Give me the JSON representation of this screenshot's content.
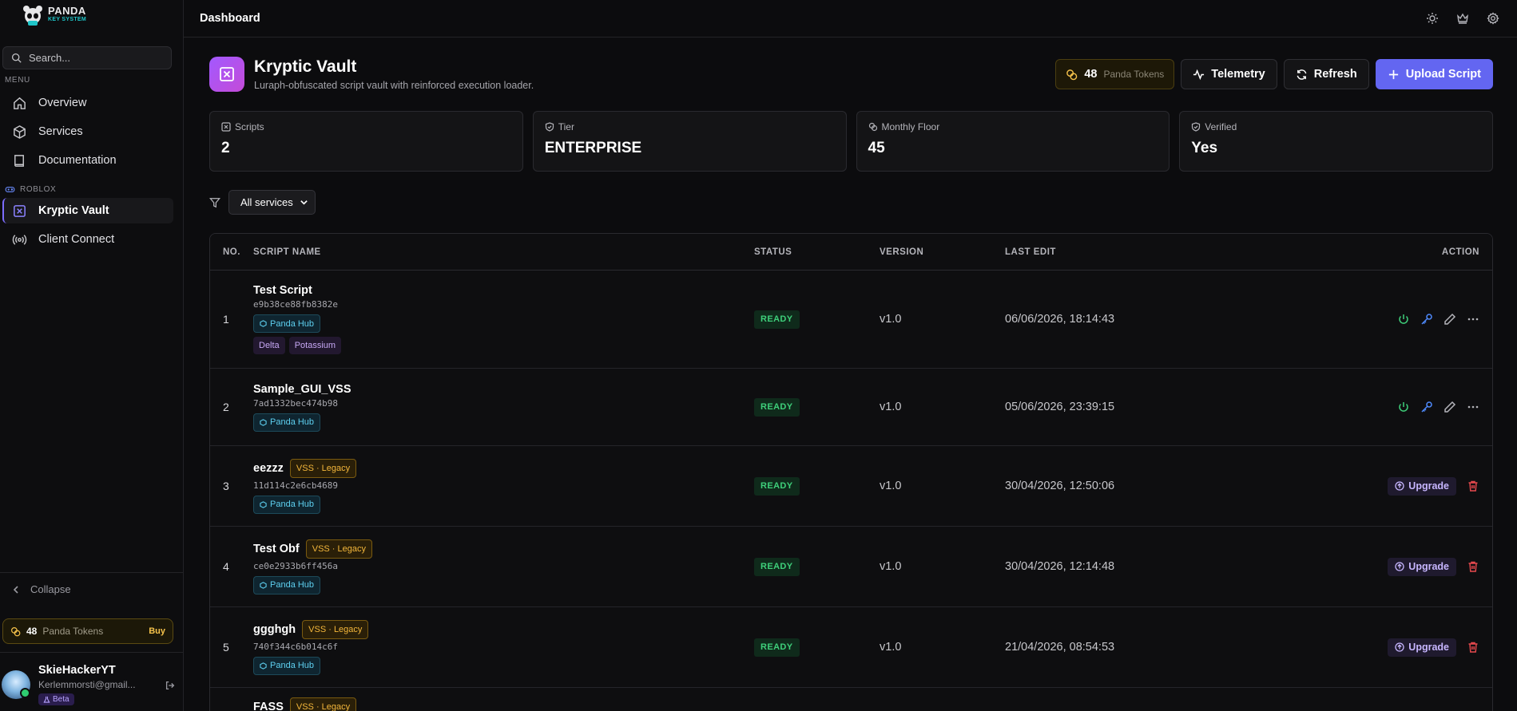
{
  "app": {
    "logo_line1": "PANDA",
    "logo_line2": "KEY SYSTEM"
  },
  "sidebar": {
    "search_placeholder": "Search...",
    "menu_label": "MENU",
    "menu_items": [
      {
        "label": "Overview",
        "icon": "home-icon"
      },
      {
        "label": "Services",
        "icon": "cube-icon"
      },
      {
        "label": "Documentation",
        "icon": "book-icon"
      }
    ],
    "roblox_label": "ROBLOX",
    "roblox_items": [
      {
        "label": "Kryptic Vault",
        "icon": "vault-icon",
        "active": true
      },
      {
        "label": "Client Connect",
        "icon": "broadcast-icon"
      }
    ],
    "collapse_label": "Collapse",
    "tokens": {
      "count": "48",
      "label": "Panda Tokens",
      "buy": "Buy"
    },
    "user": {
      "name": "SkieHackerYT",
      "email": "Kerlemmorsti@gmail...",
      "badge": "Beta"
    }
  },
  "topbar": {
    "title": "Dashboard",
    "icons": [
      "sun-icon",
      "crown-icon",
      "gear-icon"
    ]
  },
  "header": {
    "title": "Kryptic Vault",
    "subtitle": "Luraph-obfuscated script vault with reinforced execution loader.",
    "tokens_count": "48",
    "tokens_label": "Panda Tokens",
    "telemetry": "Telemetry",
    "refresh": "Refresh",
    "upload": "Upload Script"
  },
  "stats": [
    {
      "label": "Scripts",
      "value": "2"
    },
    {
      "label": "Tier",
      "value": "ENTERPRISE"
    },
    {
      "label": "Monthly Floor",
      "value": "45"
    },
    {
      "label": "Verified",
      "value": "Yes"
    }
  ],
  "filter": {
    "selected": "All services"
  },
  "table": {
    "headers": {
      "no": "NO.",
      "name": "SCRIPT NAME",
      "status": "STATUS",
      "version": "VERSION",
      "last_edit": "LAST EDIT",
      "action": "ACTION"
    },
    "rows": [
      {
        "no": "1",
        "name": "Test Script",
        "hash": "e9b38ce88fb8382e",
        "hub": "Panda Hub",
        "extra_tags": [
          "Delta",
          "Potassium"
        ],
        "legacy": "",
        "status": "READY",
        "version": "v1.0",
        "last_edit": "06/06/2026, 18:14:43",
        "upgrade": ""
      },
      {
        "no": "2",
        "name": "Sample_GUI_VSS",
        "hash": "7ad1332bec474b98",
        "hub": "Panda Hub",
        "extra_tags": [],
        "legacy": "",
        "status": "READY",
        "version": "v1.0",
        "last_edit": "05/06/2026, 23:39:15",
        "upgrade": ""
      },
      {
        "no": "3",
        "name": "eezzz",
        "hash": "11d114c2e6cb4689",
        "hub": "Panda Hub",
        "extra_tags": [],
        "legacy": "VSS · Legacy",
        "status": "READY",
        "version": "v1.0",
        "last_edit": "30/04/2026, 12:50:06",
        "upgrade": "Upgrade"
      },
      {
        "no": "4",
        "name": "Test Obf",
        "hash": "ce0e2933b6ff456a",
        "hub": "Panda Hub",
        "extra_tags": [],
        "legacy": "VSS · Legacy",
        "status": "READY",
        "version": "v1.0",
        "last_edit": "30/04/2026, 12:14:48",
        "upgrade": "Upgrade"
      },
      {
        "no": "5",
        "name": "ggghgh",
        "hash": "740f344c6b014c6f",
        "hub": "Panda Hub",
        "extra_tags": [],
        "legacy": "VSS · Legacy",
        "status": "READY",
        "version": "v1.0",
        "last_edit": "21/04/2026, 08:54:53",
        "upgrade": "Upgrade"
      },
      {
        "no": "",
        "name": "FASS",
        "hash": "",
        "hub": "",
        "extra_tags": [],
        "legacy": "VSS · Legacy",
        "status": "",
        "version": "",
        "last_edit": "",
        "upgrade": ""
      }
    ]
  },
  "colors": {
    "accent": "#6366f1",
    "ready": "#3ecf7a",
    "legacy": "#f4b73b",
    "hub": "#5ed0f0",
    "danger": "#e5484d"
  }
}
